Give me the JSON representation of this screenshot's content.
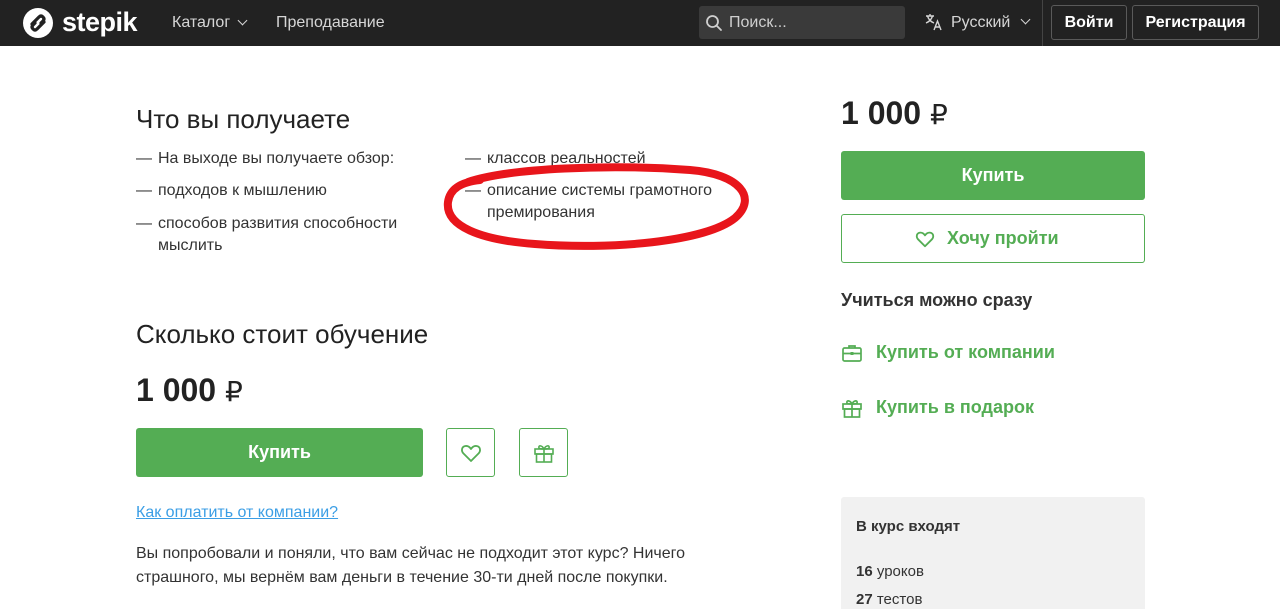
{
  "header": {
    "logo_text": "stepik",
    "nav_catalog": "Каталог",
    "nav_teaching": "Преподавание",
    "search_placeholder": "Поиск...",
    "language": "Русский",
    "login": "Войти",
    "register": "Регистрация"
  },
  "what_you_get": {
    "title": "Что вы получаете",
    "items": [
      "На выходе вы получаете обзор:",
      "подходов к мышлению",
      "способов развития способности мыслить",
      "классов реальностей",
      "описание системы грамотного премирования"
    ],
    "dash": "—"
  },
  "pricing": {
    "title": "Сколько стоит обучение",
    "price_value": "1 000",
    "currency": "₽",
    "buy": "Купить",
    "company_link": "Как оплатить от компании?",
    "refund_text": "Вы попробовали и поняли, что вам сейчас не подходит этот курс? Ничего страшного, мы вернём вам деньги в течение 30-ти дней после покупки."
  },
  "sidebar": {
    "price_value": "1 000",
    "currency": "₽",
    "buy": "Купить",
    "want": "Хочу пройти",
    "learn_now": "Учиться можно сразу",
    "buy_company": "Купить от компании",
    "buy_gift": "Купить в подарок",
    "includes": {
      "title": "В курс входят",
      "lessons_count": "16",
      "lessons_label": "уроков",
      "tests_count": "27",
      "tests_label": "тестов"
    }
  },
  "colors": {
    "header_bg": "#222222",
    "accent_green": "#54ad54",
    "link_blue": "#3b9ee5",
    "annotation_red": "#e8151b"
  },
  "icons": [
    "stepik-logo-icon",
    "search-icon",
    "translate-icon",
    "heart-icon",
    "gift-icon",
    "briefcase-icon"
  ]
}
